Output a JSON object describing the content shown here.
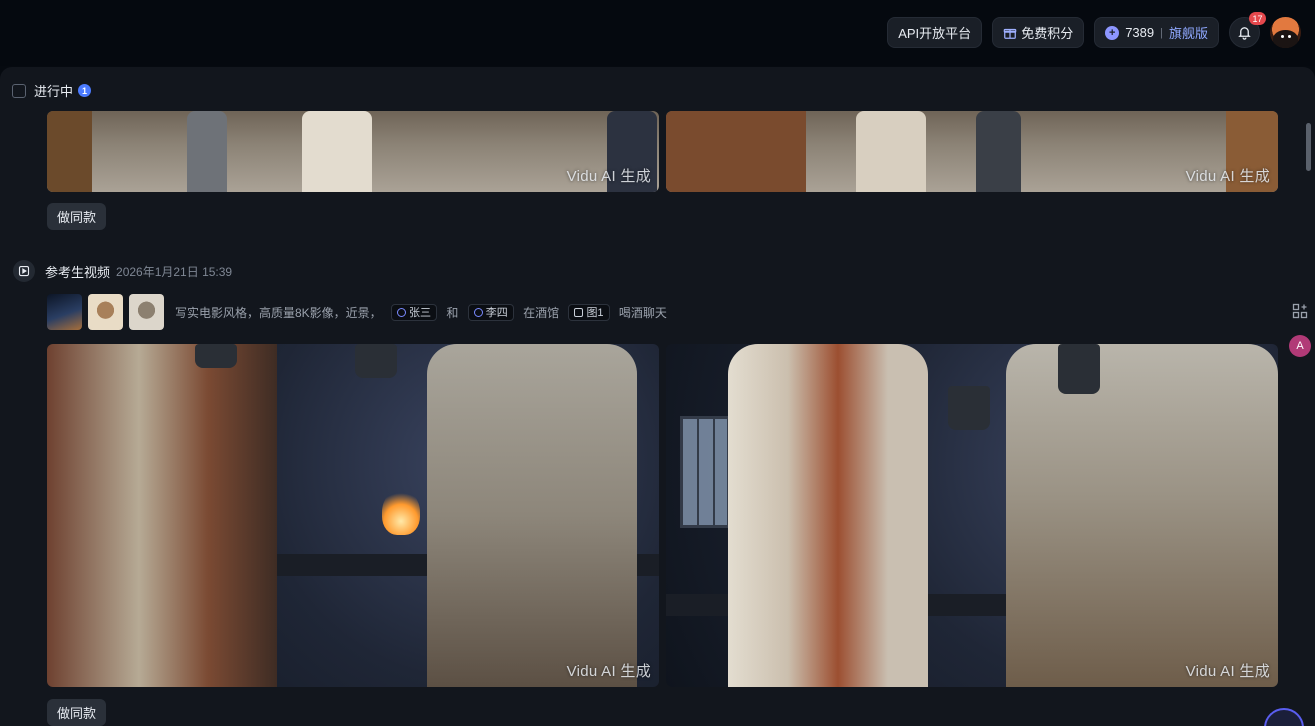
{
  "topbar": {
    "api_label": "API开放平台",
    "free_points_label": "免费积分",
    "points_value": "7389",
    "separator": "|",
    "tier_label": "旗舰版",
    "notification_count": "17",
    "accent": "#8fa8ff"
  },
  "status": {
    "label": "进行中",
    "count": "1"
  },
  "first_task": {
    "watermarks": [
      "Vidu AI 生成",
      "Vidu AI 生成"
    ],
    "make_same_label": "做同款"
  },
  "second_task": {
    "title": "参考生视频",
    "time": "2026年1月21日 15:39",
    "prompt_parts": {
      "p1": "写实电影风格，高质量8K影像，近景，",
      "tag1": "张三",
      "p2": "和",
      "tag2": "李四",
      "p3": "在酒馆",
      "tag3": "图1",
      "p4": "喝酒聊天"
    },
    "watermarks": [
      "Vidu AI 生成",
      "Vidu AI 生成"
    ],
    "make_same_label": "做同款"
  },
  "side_tools": {
    "translate_glyph": "A"
  }
}
